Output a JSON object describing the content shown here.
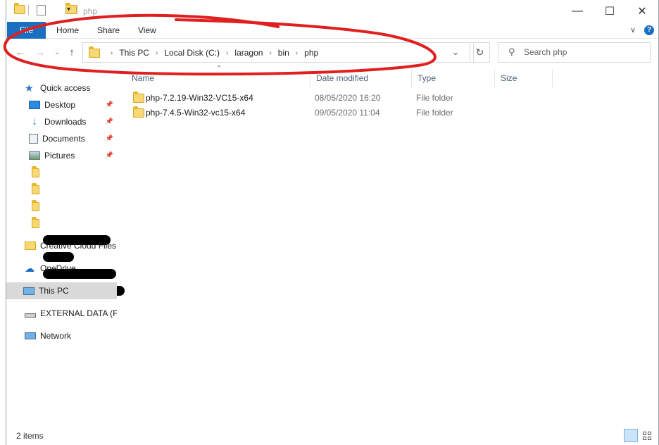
{
  "title": "php",
  "ribbon": {
    "tabs": [
      "File",
      "Home",
      "Share",
      "View"
    ]
  },
  "address": {
    "crumbs": [
      "This PC",
      "Local Disk (C:)",
      "laragon",
      "bin",
      "php"
    ]
  },
  "search": {
    "placeholder": "Search php"
  },
  "columns": [
    "Name",
    "Date modified",
    "Type",
    "Size"
  ],
  "files": [
    {
      "name": "php-7.2.19-Win32-VC15-x64",
      "date": "08/05/2020 16:20",
      "type": "File folder"
    },
    {
      "name": "php-7.4.5-Win32-vc15-x64",
      "date": "09/05/2020 11:04",
      "type": "File folder"
    }
  ],
  "nav": {
    "quick_access": "Quick access",
    "desktop": "Desktop",
    "downloads": "Downloads",
    "documents": "Documents",
    "pictures": "Pictures",
    "creative_cloud": "Creative Cloud Files",
    "onedrive": "OneDrive",
    "this_pc": "This PC",
    "external": "EXTERNAL DATA (F:)",
    "network": "Network"
  },
  "status": {
    "items": "2 items"
  },
  "colors": {
    "accent": "#1a6fc1",
    "annotation": "#e02020",
    "folder": "#f8d775"
  }
}
